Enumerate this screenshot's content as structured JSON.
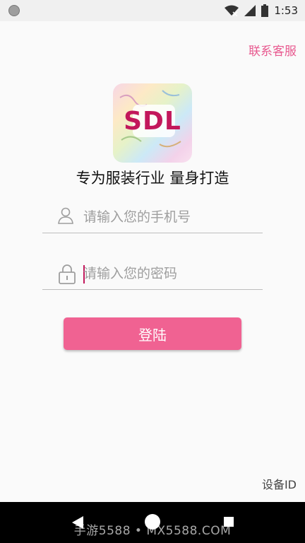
{
  "status_bar": {
    "time": "1:53"
  },
  "header": {
    "contact_label": "联系客服"
  },
  "logo": {
    "text": "SDL"
  },
  "slogan": "专为服装行业 量身打造",
  "form": {
    "phone_placeholder": "请输入您的手机号",
    "password_placeholder": "请输入您的密码",
    "login_label": "登陆"
  },
  "footer": {
    "device_id_label": "设备ID"
  },
  "watermark": "手游5588 • MX5588.COM",
  "colors": {
    "accent": "#f06292",
    "brand": "#c2185b"
  }
}
